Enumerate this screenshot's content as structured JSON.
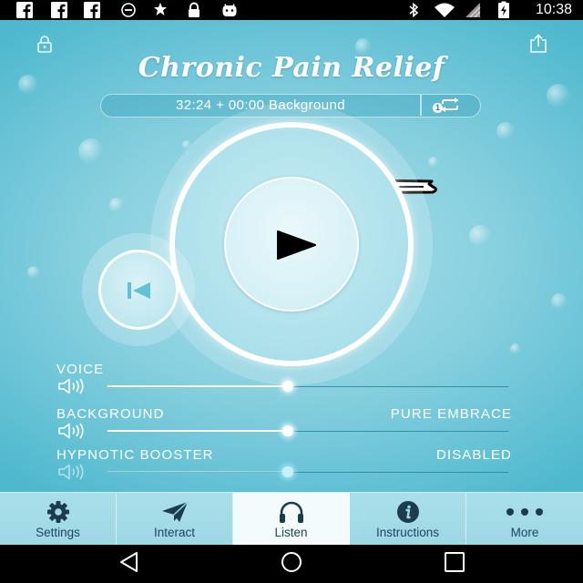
{
  "status_bar": {
    "time": "10:38",
    "left_icons": [
      "facebook-icon",
      "facebook-icon",
      "facebook-icon",
      "circle-icon",
      "fake-gps-icon",
      "lock-icon",
      "android-icon"
    ],
    "right_icons": [
      "bluetooth-icon",
      "wifi-icon",
      "no-signal-icon",
      "battery-charging-icon"
    ]
  },
  "header": {
    "title": "Chronic Pain Relief",
    "left_icon": "lock-icon",
    "right_icon": "share-icon"
  },
  "session_bar": {
    "duration": "32:24 + 00:00 Background",
    "repeat_icon": "repeat-icon",
    "repeat_count": "1"
  },
  "player": {
    "play_icon": "play-icon",
    "previous_icon": "skip-back-icon"
  },
  "mixer": [
    {
      "label": "VOICE",
      "icon": "volume-icon",
      "level": 0.45,
      "enabled": true
    },
    {
      "label": "BACKGROUND",
      "value": "PURE EMBRACE",
      "icon": "volume-icon",
      "level": 0.45,
      "enabled": true
    },
    {
      "label": "HYPNOTIC BOOSTER",
      "value": "DISABLED",
      "icon": "volume-icon",
      "level": 0.45,
      "enabled": false
    }
  ],
  "tabs": [
    {
      "label": "Settings",
      "icon": "gear-icon",
      "active": false
    },
    {
      "label": "Interact",
      "icon": "paper-plane-icon",
      "active": false
    },
    {
      "label": "Listen",
      "icon": "headphones-icon",
      "active": true
    },
    {
      "label": "Instructions",
      "icon": "info-icon",
      "active": false
    },
    {
      "label": "More",
      "icon": "more-icon",
      "active": false
    }
  ],
  "nav_bar": {
    "icons": [
      "back-icon",
      "home-icon",
      "recents-icon"
    ]
  },
  "colors": {
    "bg_edge": "#4eb8ce",
    "bg_center": "#a8dfe9",
    "tab_bar": "#9ed8e4",
    "active_tab": "#f3fbfd",
    "tab_icon": "#1c3c4b",
    "track_remaining": "#2f90a7",
    "skip_icon": "#62c1d5"
  }
}
